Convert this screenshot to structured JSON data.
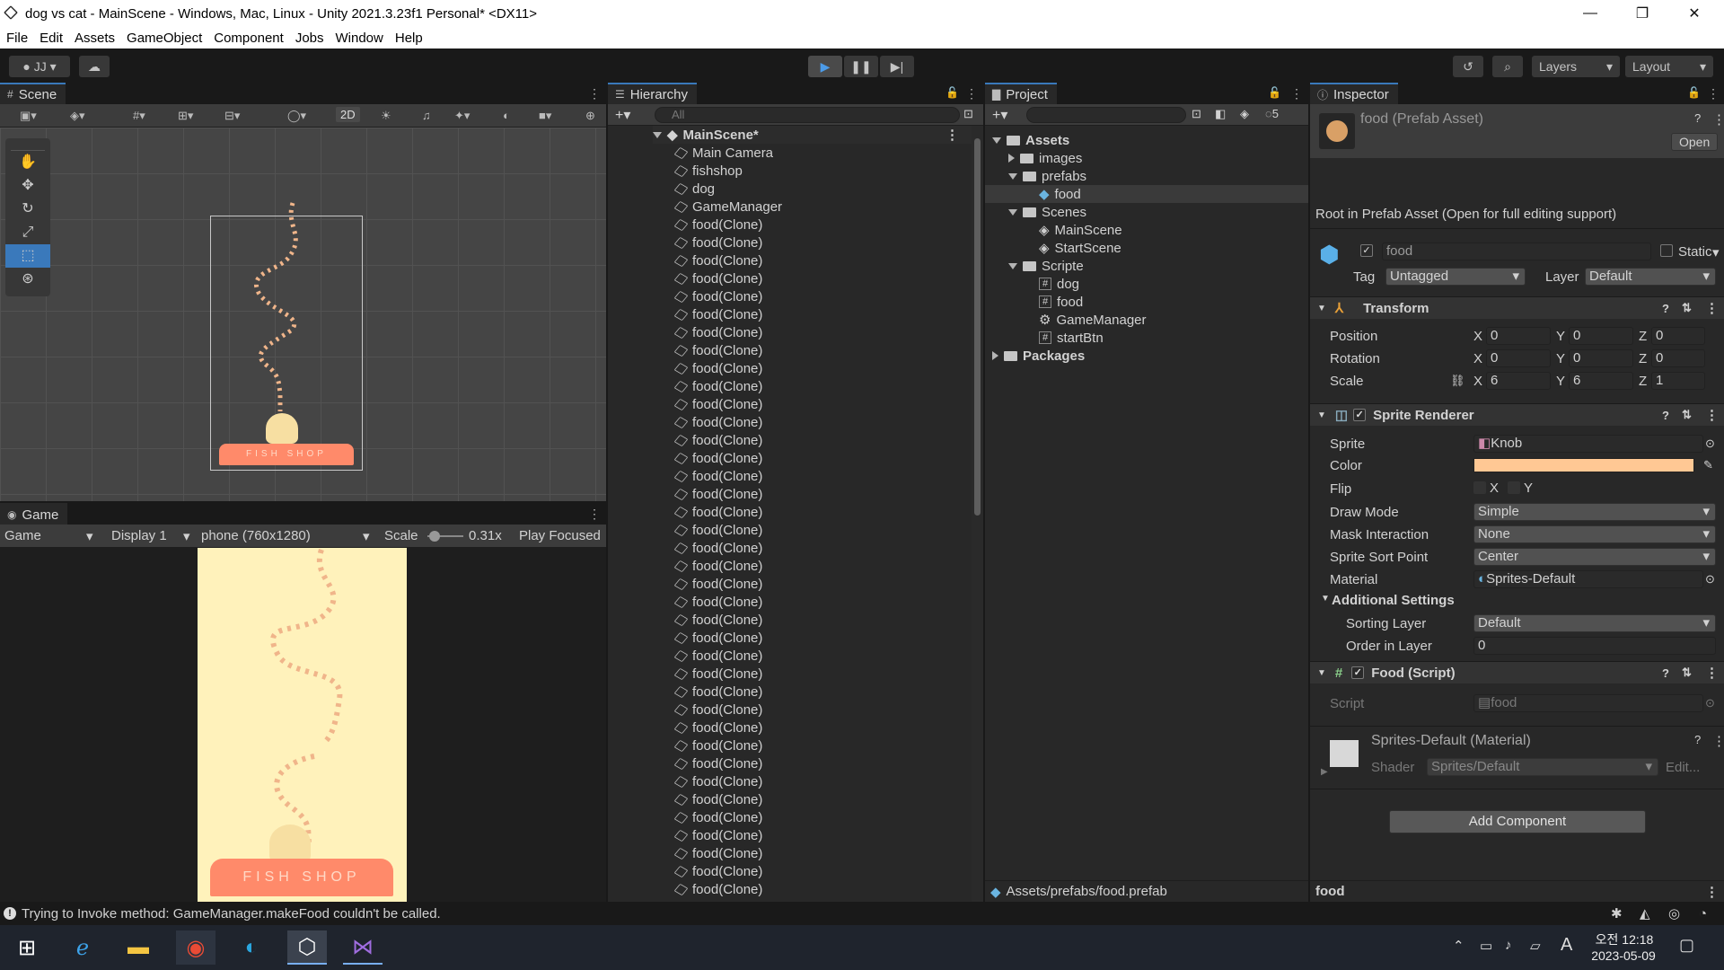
{
  "window": {
    "title": "dog vs cat - MainScene - Windows, Mac, Linux - Unity 2021.3.23f1 Personal* <DX11>"
  },
  "menu": [
    "File",
    "Edit",
    "Assets",
    "GameObject",
    "Component",
    "Jobs",
    "Window",
    "Help"
  ],
  "toolbar": {
    "account": "JJ",
    "layers": "Layers",
    "layout": "Layout"
  },
  "scene": {
    "tab": "Scene",
    "mode_2d": "2D"
  },
  "game": {
    "tab": "Game",
    "view": "Game",
    "display": "Display 1",
    "resolution": "phone (760x1280)",
    "scale_label": "Scale",
    "scale_value": "0.31x",
    "play_mode": "Play Focused",
    "shop_sign": "FISH SHOP"
  },
  "hierarchy": {
    "tab": "Hierarchy",
    "search_placeholder": "All",
    "scene": "MainScene*",
    "items": [
      "Main Camera",
      "fishshop",
      "dog",
      "GameManager"
    ],
    "clone_name": "food(Clone)",
    "clone_count": 42
  },
  "project": {
    "tab": "Project",
    "badge": "5",
    "tree": [
      {
        "label": "Assets",
        "depth": 0,
        "type": "folder",
        "bold": true,
        "open": true
      },
      {
        "label": "images",
        "depth": 1,
        "type": "folder",
        "open": false
      },
      {
        "label": "prefabs",
        "depth": 1,
        "type": "folder",
        "open": true
      },
      {
        "label": "food",
        "depth": 2,
        "type": "prefab",
        "selected": true
      },
      {
        "label": "Scenes",
        "depth": 1,
        "type": "folder",
        "open": true
      },
      {
        "label": "MainScene",
        "depth": 2,
        "type": "scene"
      },
      {
        "label": "StartScene",
        "depth": 2,
        "type": "scene"
      },
      {
        "label": "Scripte",
        "depth": 1,
        "type": "folder",
        "open": true
      },
      {
        "label": "dog",
        "depth": 2,
        "type": "script"
      },
      {
        "label": "food",
        "depth": 2,
        "type": "script"
      },
      {
        "label": "GameManager",
        "depth": 2,
        "type": "gear"
      },
      {
        "label": "startBtn",
        "depth": 2,
        "type": "script"
      },
      {
        "label": "Packages",
        "depth": 0,
        "type": "folder",
        "bold": true,
        "open": false
      }
    ],
    "path": "Assets/prefabs/food.prefab"
  },
  "inspector": {
    "tab": "Inspector",
    "asset_title": "food (Prefab Asset)",
    "open_btn": "Open",
    "root_note": "Root in Prefab Asset (Open for full editing support)",
    "name": "food",
    "static": "Static",
    "tag_label": "Tag",
    "tag": "Untagged",
    "layer_label": "Layer",
    "layer": "Default",
    "transform": {
      "title": "Transform",
      "position": [
        "0",
        "0",
        "0"
      ],
      "rotation": [
        "0",
        "0",
        "0"
      ],
      "scale": [
        "6",
        "6",
        "1"
      ],
      "labels": [
        "Position",
        "Rotation",
        "Scale"
      ]
    },
    "sprite_renderer": {
      "title": "Sprite Renderer",
      "sprite_label": "Sprite",
      "sprite": "Knob",
      "color_label": "Color",
      "color": "#ffc894",
      "flip_label": "Flip",
      "draw_mode_label": "Draw Mode",
      "draw_mode": "Simple",
      "mask_label": "Mask Interaction",
      "mask": "None",
      "sort_point_label": "Sprite Sort Point",
      "sort_point": "Center",
      "material_label": "Material",
      "material": "Sprites-Default",
      "additional": "Additional Settings",
      "sorting_layer_label": "Sorting Layer",
      "sorting_layer": "Default",
      "order_label": "Order in Layer",
      "order": "0"
    },
    "food_script": {
      "title": "Food (Script)",
      "script_label": "Script",
      "script": "food"
    },
    "material": {
      "title": "Sprites-Default (Material)",
      "shader_label": "Shader",
      "shader": "Sprites/Default",
      "edit": "Edit..."
    },
    "add_component": "Add Component",
    "footer": "food"
  },
  "status": {
    "message": "Trying to Invoke method: GameManager.makeFood couldn't be called."
  },
  "taskbar": {
    "ime": "A",
    "ampm_time": "오전 12:18",
    "date": "2023-05-09"
  },
  "axes": {
    "x": "X",
    "y": "Y",
    "z": "Z"
  }
}
